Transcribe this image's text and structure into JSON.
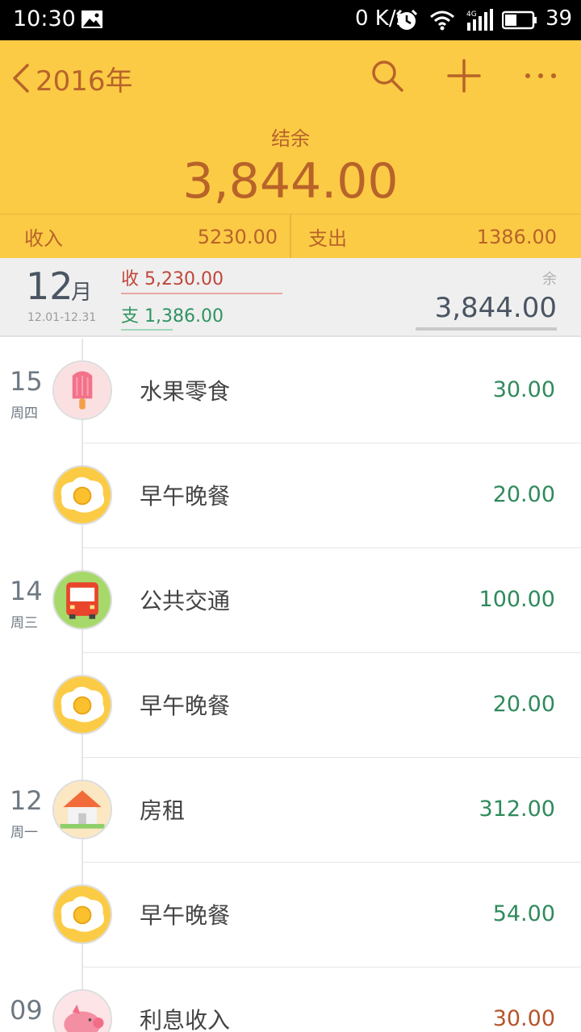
{
  "status_bar": {
    "time": "10:30",
    "net_speed": "0 K/s",
    "battery_level": "39",
    "signal_label": "4G"
  },
  "header": {
    "back_label": "2016年",
    "balance_label": "结余",
    "balance_value": "3,844.00",
    "accent_color": "#fbcb45",
    "text_color": "#b8632a"
  },
  "summary": {
    "income_label": "收入",
    "income_value": "5230.00",
    "expense_label": "支出",
    "expense_value": "1386.00"
  },
  "month": {
    "number": "12",
    "unit": "月",
    "range": "12.01-12.31",
    "income": "收 5,230.00",
    "expense": "支 1,386.00",
    "remainder_label": "余",
    "remainder_value": "3,844.00"
  },
  "transactions": [
    {
      "day": "15",
      "weekday": "周四",
      "icon": "popsicle-icon",
      "category": "水果零食",
      "amount": "30.00",
      "type": "expense"
    },
    {
      "day": "",
      "weekday": "",
      "icon": "fried-egg-icon",
      "category": "早午晚餐",
      "amount": "20.00",
      "type": "expense"
    },
    {
      "day": "14",
      "weekday": "周三",
      "icon": "bus-icon",
      "category": "公共交通",
      "amount": "100.00",
      "type": "expense"
    },
    {
      "day": "",
      "weekday": "",
      "icon": "fried-egg-icon",
      "category": "早午晚餐",
      "amount": "20.00",
      "type": "expense"
    },
    {
      "day": "12",
      "weekday": "周一",
      "icon": "house-icon",
      "category": "房租",
      "amount": "312.00",
      "type": "expense"
    },
    {
      "day": "",
      "weekday": "",
      "icon": "fried-egg-icon",
      "category": "早午晚餐",
      "amount": "54.00",
      "type": "expense"
    },
    {
      "day": "09",
      "weekday": "",
      "icon": "piggy-bank-icon",
      "category": "利息收入",
      "amount": "30.00",
      "type": "income"
    }
  ],
  "colors": {
    "expense_amount": "#2f8a5c",
    "income_amount": "#b6542a",
    "month_income": "#c0463a",
    "month_expense": "#2f9462"
  }
}
